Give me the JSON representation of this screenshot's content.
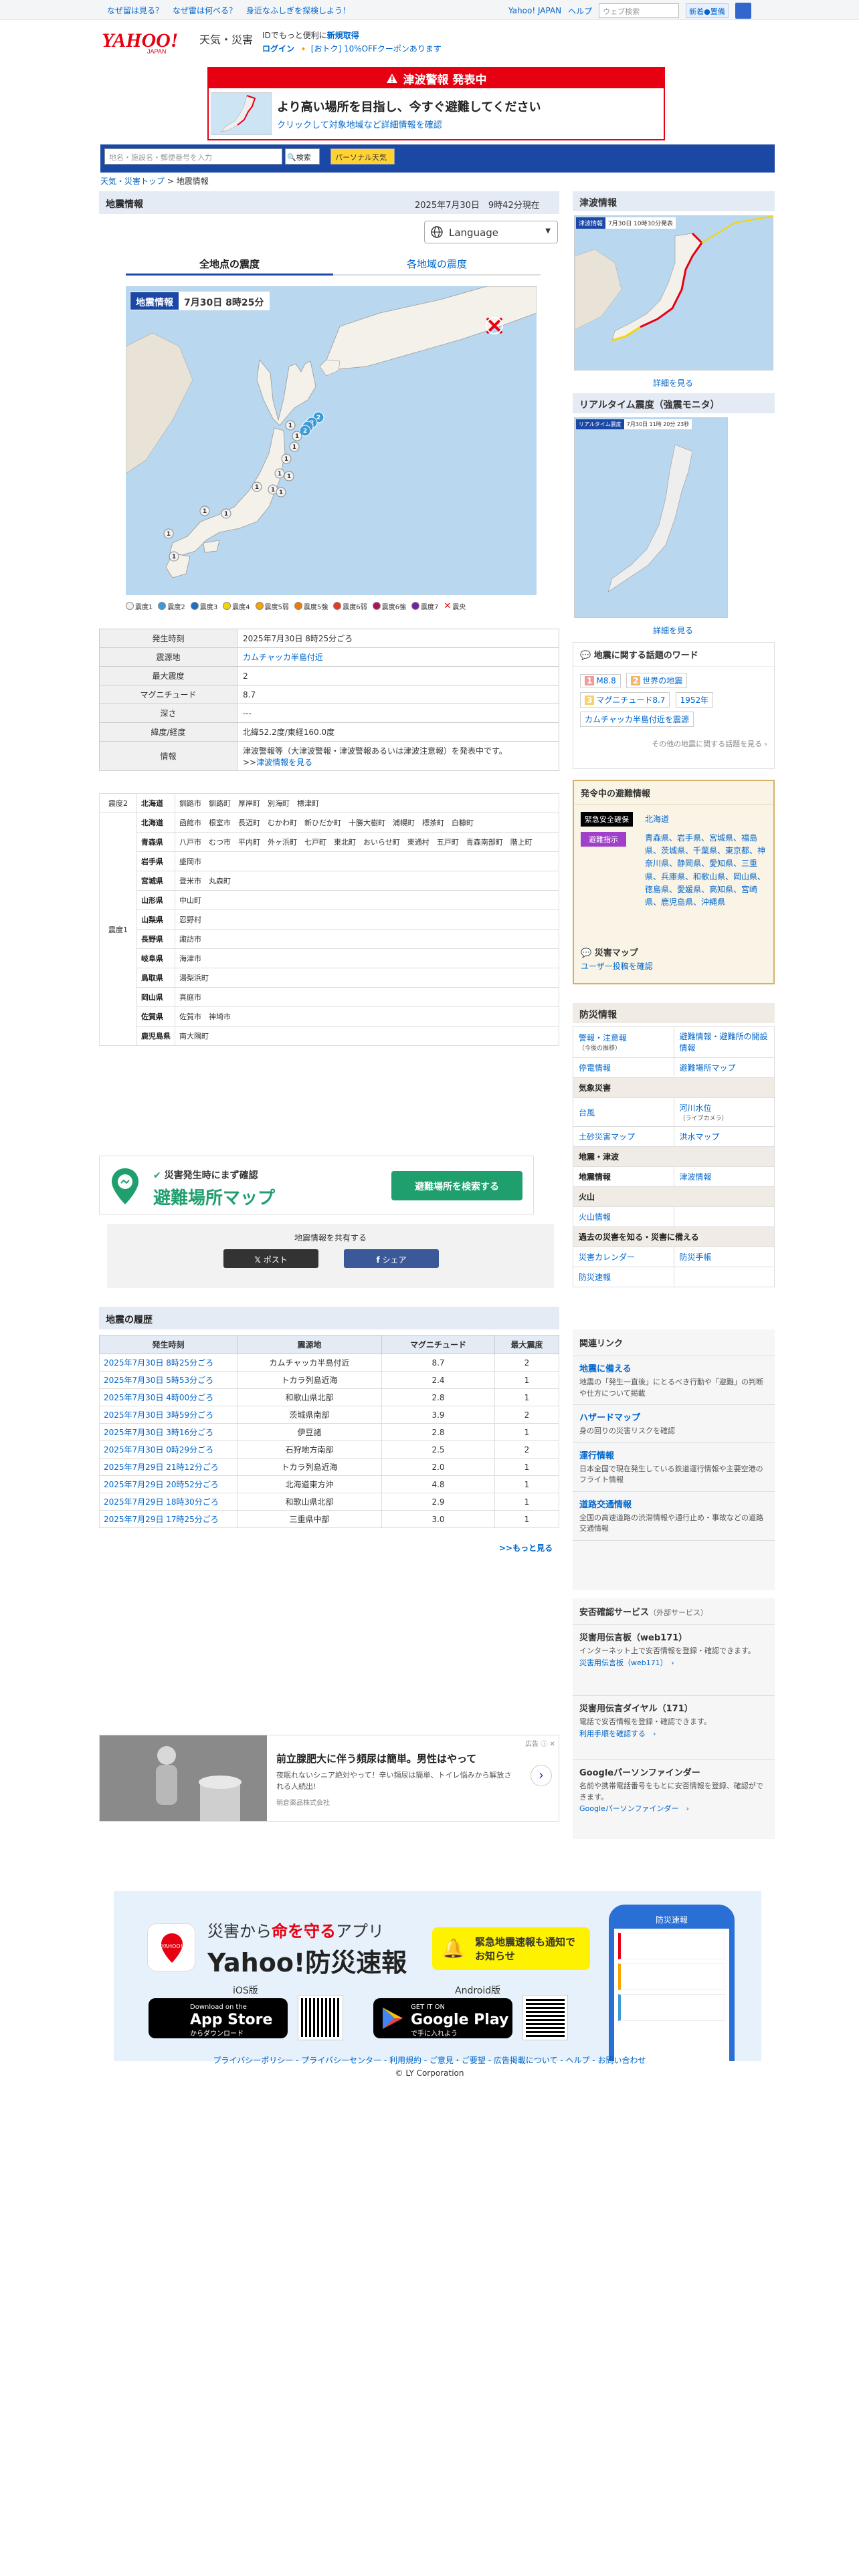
{
  "toplinks": [
    "なぜ留は見る？",
    "なぜ雷は何べる？",
    "身近なふしぎを探検しよう！"
  ],
  "top_right": {
    "yahoo": "Yahoo! JAPAN",
    "help": "ヘルプ",
    "search_placeholder": "ウェブ検索",
    "btn": "新着●置備"
  },
  "header": {
    "service": "天気・災害",
    "promo1_a": "IDでもっと便利に",
    "promo1_b": "新規取得",
    "login": "ログイン",
    "promo2": "[おトク] 10%OFFクーポンあります"
  },
  "alert": {
    "head": "津波警報 発表中",
    "title": "より高い場所を目指し、今すぐ避難してください",
    "sub": "クリックして対象地域など詳細情報を確認"
  },
  "searchbar": {
    "placeholder": "地名・施設名・郵便番号を入力",
    "btn1": "検索",
    "btn2": "パーソナル天気"
  },
  "breadcrumb": {
    "a": "天気・災害トップ",
    "b": "地震情報"
  },
  "main": {
    "title": "地震情報",
    "datetime": "2025年7月30日　9時42分現在",
    "language": "Language",
    "tab1": "全地点の震度",
    "tab2": "各地域の震度",
    "map_label": "地震情報",
    "map_date": "7月30日 8時25分"
  },
  "legend": [
    "震度1",
    "震度2",
    "震度3",
    "震度4",
    "震度5弱",
    "震度5強",
    "震度6弱",
    "震度6強",
    "震度7",
    "震央"
  ],
  "legend_colors": [
    "#f2f2f2",
    "#3c9bd6",
    "#1b6ec2",
    "#f5d600",
    "#f7a400",
    "#f07b00",
    "#e63c1e",
    "#b3105a",
    "#7a1fa2",
    "#e60012"
  ],
  "info": [
    {
      "k": "発生時刻",
      "v": "2025年7月30日 8時25分ごろ"
    },
    {
      "k": "震源地",
      "v": "カムチャッカ半島付近"
    },
    {
      "k": "最大震度",
      "v": "2"
    },
    {
      "k": "マグニチュード",
      "v": "8.7"
    },
    {
      "k": "深さ",
      "v": "---"
    },
    {
      "k": "緯度/経度",
      "v": "北緯52.2度/東経160.0度"
    },
    {
      "k": "情報",
      "v": "津波警報等（大津波警報・津波警報あるいは津波注意報）を発表中です。"
    }
  ],
  "info_link": "津波情報を見る",
  "dist": {
    "s2_label": "震度2",
    "s2_pref": "北海道",
    "s2_cities": "釧路市　釧路町　厚岸町　別海町　標津町",
    "s1_label": "震度1",
    "rows": [
      {
        "p": "北海道",
        "c": "函館市　根室市　長迈町　むかわ町　新ひだか町　十勝大樹町　浦幌町　標茶町　白糠町"
      },
      {
        "p": "青森県",
        "c": "八戸市　むつ市　平内町　外ヶ浜町　七戸町　東北町　おいらせ町　東通村　五戸町　青森南部町　階上町"
      },
      {
        "p": "岩手県",
        "c": "盛岡市"
      },
      {
        "p": "宮城県",
        "c": "登米市　丸森町"
      },
      {
        "p": "山形県",
        "c": "中山町"
      },
      {
        "p": "山梨県",
        "c": "忍野村"
      },
      {
        "p": "長野県",
        "c": "諏訪市"
      },
      {
        "p": "岐阜県",
        "c": "海津市"
      },
      {
        "p": "鳥取県",
        "c": "湯梨浜町"
      },
      {
        "p": "岡山県",
        "c": "真庭市"
      },
      {
        "p": "佐賀県",
        "c": "佐賀市　神埼市"
      },
      {
        "p": "鹿児島県",
        "c": "南大隅町"
      }
    ]
  },
  "mapbanner": {
    "sub": "災害発生時にまず確認",
    "title": "避難場所マップ",
    "btn": "避難場所を検索する"
  },
  "share": {
    "title": "地震情報を共有する",
    "x": "ポスト",
    "fb": "シェア"
  },
  "history": {
    "title": "地震の履歴",
    "cols": [
      "発生時刻",
      "震源地",
      "マグニチュード",
      "最大震度"
    ],
    "rows": [
      [
        "2025年7月30日 8時25分ごろ",
        "カムチャッカ半島付近",
        "8.7",
        "2"
      ],
      [
        "2025年7月30日 5時53分ごろ",
        "トカラ列島近海",
        "2.4",
        "1"
      ],
      [
        "2025年7月30日 4時00分ごろ",
        "和歌山県北部",
        "2.8",
        "1"
      ],
      [
        "2025年7月30日 3時59分ごろ",
        "茨城県南部",
        "3.9",
        "2"
      ],
      [
        "2025年7月30日 3時16分ごろ",
        "伊豆諸",
        "2.8",
        "1"
      ],
      [
        "2025年7月30日 0時29分ごろ",
        "石狩地方南部",
        "2.5",
        "2"
      ],
      [
        "2025年7月29日 21時12分ごろ",
        "トカラ列島近海",
        "2.0",
        "1"
      ],
      [
        "2025年7月29日 20時52分ごろ",
        "北海道東方沖",
        "4.8",
        "1"
      ],
      [
        "2025年7月29日 18時30分ごろ",
        "和歌山県北部",
        "2.9",
        "1"
      ],
      [
        "2025年7月29日 17時25分ごろ",
        "三重県中部",
        "3.0",
        "1"
      ]
    ],
    "more": ">>もっと見る"
  },
  "ad": {
    "label": "広告",
    "title": "前立腺肥大に伴う頻尿は簡単。男性はやって",
    "desc": "夜眠れないシニア絶対やって！辛い頻尿は簡単、トイレ悩みから解放される人続出!",
    "sponsor": "朝倉薬品株式会社"
  },
  "app": {
    "tag1": "災害から",
    "tag2": "命を守る",
    "tag3": "アプリ",
    "name": "Yahoo!防災速報",
    "badge": "緊急地震速報も通知でお知らせ",
    "ios": "iOS版",
    "android": "Android版",
    "appstore_small": "Download on the",
    "appstore": "App Store",
    "appstore_sub": "からダウンロード",
    "gp_small": "GET IT ON",
    "gp": "Google Play",
    "gp_sub": "で手に入れよう",
    "phone_title": "防災速報"
  },
  "side": {
    "tsunami_title": "津波情報",
    "tsunami_map_label": "津波情報",
    "tsunami_map_date": "7月30日 10時30分発表",
    "tsunami_more": "詳細を見る",
    "realtime_title": "リアルタイム震度（強震モニタ）",
    "realtime_label": "リアルタイム震度",
    "realtime_date": "7月30日 11時 20分 23秒",
    "realtime_more": "詳細を見る",
    "words_title": "地震に関する話題のワード",
    "words": [
      {
        "n": "1",
        "t": "M8.8"
      },
      {
        "n": "2",
        "t": "世界の地震"
      },
      {
        "n": "3",
        "t": "マグニチュード8.7"
      },
      {
        "n": "",
        "t": "1952年"
      },
      {
        "n": "",
        "t": "カムチャッカ半島付近を震源"
      }
    ],
    "words_more": "その他の地震に関する話題を見る ›",
    "evac_title": "発令中の避難情報",
    "evac_k1": "緊急安全確保",
    "evac_v1": "北海道",
    "evac_k2": "避難指示",
    "evac_v2": "青森県、岩手県、宮城県、福島県、茨城県、千葉県、東京都、神奈川県、静岡県、愛知県、三重県、兵庫県、和歌山県、岡山県、徳島県、愛媛県、高知県、宮崎県、鹿児島県、沖縄県",
    "evac_map": "災害マップ",
    "evac_map_sub": "ユーザー投稿を確認",
    "dis_title": "防災情報",
    "dis": [
      [
        "警報・注意報",
        "避難情報・避難所の開設情報"
      ],
      [
        "停電情報",
        "避難場所マップ"
      ],
      [
        "H:気象災害",
        ""
      ],
      [
        "台風",
        "河川水位"
      ],
      [
        "土砂災害マップ",
        "洪水マップ"
      ],
      [
        "H:地震・津波",
        ""
      ],
      [
        "地震情報",
        "津波情報"
      ],
      [
        "H:火山",
        ""
      ],
      [
        "火山情報",
        ""
      ],
      [
        "H:過去の災害を知る・災害に備える",
        ""
      ],
      [
        "災害カレンダー",
        "防災手帳"
      ],
      [
        "防災速報",
        ""
      ]
    ],
    "dis_sub1": "（今後の推移）",
    "dis_sub2": "（ライブカメラ）",
    "rel_title": "関連リンク",
    "rel": [
      {
        "t": "地震に備える",
        "d": "地震の「発生一直後」にとるべき行動や「避難」の判断や仕方について掲載"
      },
      {
        "t": "ハザードマップ",
        "d": "身の回りの災害リスクを確認"
      },
      {
        "t": "運行情報",
        "d": "日本全国で現在発生している鉄道運行情報や主要空港のフライト情報"
      },
      {
        "t": "道路交通情報",
        "d": "全国の高速道路の渋滞情報や通行止め・事故などの道路交通情報"
      }
    ],
    "safe_title": "安否確認サービス",
    "safe_sub": "（外部サービス）",
    "safe": [
      {
        "t": "災害用伝言板（web171）",
        "d": "インターネット上で安否情報を登録・確認できます。",
        "l": "災害用伝言板（web171）　›"
      },
      {
        "t": "災害用伝言ダイヤル（171）",
        "d": "電話で安否情報を登録・確認できます。",
        "l": "利用手順を確認する　›"
      },
      {
        "t": "Googleパーソンファインダー",
        "d": "名前や携帯電話番号をもとに安否情報を登録、確認ができます。",
        "l": "Googleパーソンファインダー　›"
      }
    ]
  },
  "footer": {
    "links": "プライバシーポリシー - プライバシーセンター - 利用規約 - ご意見・ご要望 - 広告掲載について - ヘルプ - お問い合わせ",
    "copy": "© LY Corporation"
  }
}
